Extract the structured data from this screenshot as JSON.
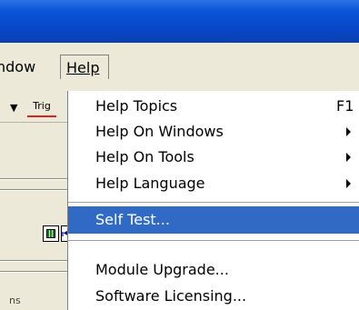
{
  "menubar": {
    "window_label": "ndow",
    "help_label": "Help"
  },
  "toolbar": {
    "trig_label": "Trig"
  },
  "status": {
    "text": "ns"
  },
  "help_menu": {
    "items": [
      {
        "label": "Help Topics",
        "shortcut": "F1",
        "submenu": false
      },
      {
        "label": "Help On Windows",
        "submenu": true
      },
      {
        "label": "Help On Tools",
        "submenu": true
      },
      {
        "label": "Help Language",
        "submenu": true
      },
      {
        "label": "Self Test...",
        "submenu": false,
        "selected": true
      },
      {
        "label": "Module Upgrade...",
        "submenu": false
      },
      {
        "label": "Software Licensing...",
        "submenu": false
      }
    ]
  },
  "colors": {
    "titlebar": "#0b55d8",
    "menubar_bg": "#ece9d8",
    "highlight": "#316ac5",
    "trig_underline": "#e02020"
  },
  "icons": [
    "dropdown-arrow-icon",
    "calculator-icon",
    "skip-back-icon",
    "submenu-arrow-icon"
  ]
}
